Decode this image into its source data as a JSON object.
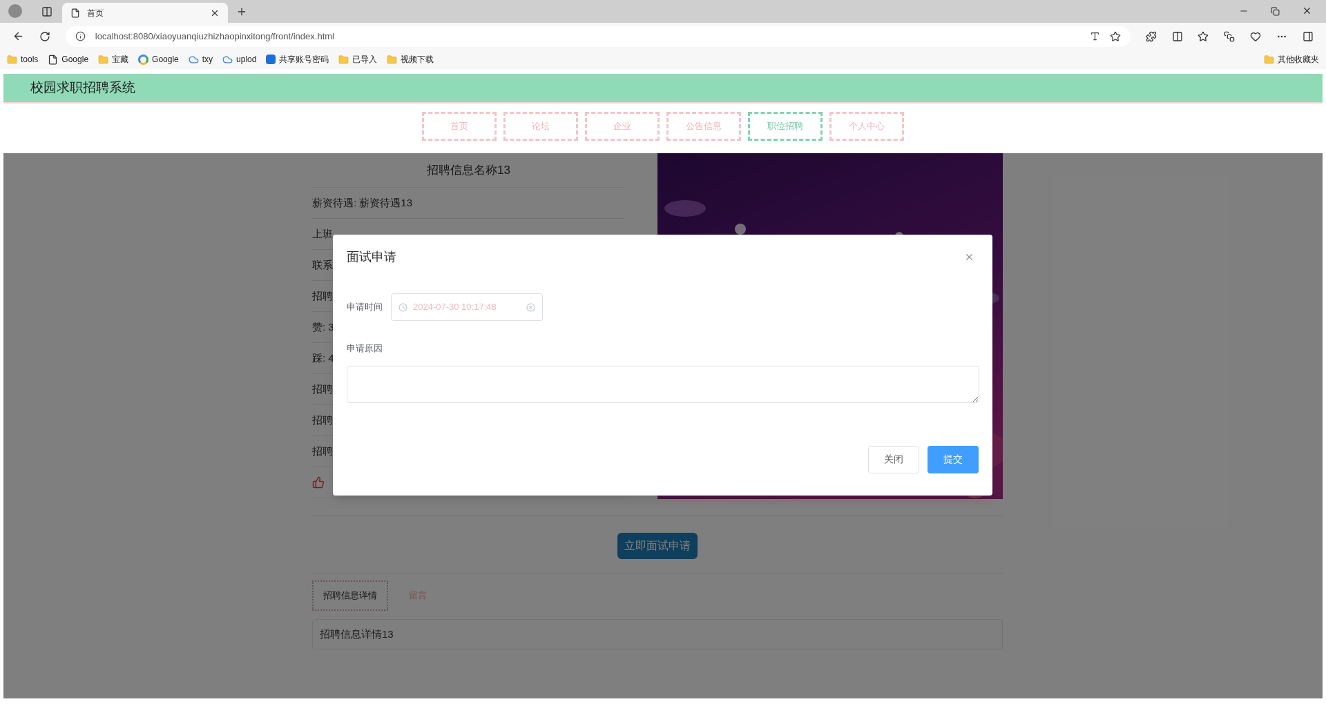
{
  "browser": {
    "tab_title": "首页",
    "url": "localhost:8080/xiaoyuanqiuzhizhaopinxitong/front/index.html",
    "bookmarks": [
      {
        "label": "tools",
        "kind": "folder"
      },
      {
        "label": "Google",
        "kind": "page"
      },
      {
        "label": "宝藏",
        "kind": "folder"
      },
      {
        "label": "Google",
        "kind": "google"
      },
      {
        "label": "txy",
        "kind": "cloud"
      },
      {
        "label": "uplod",
        "kind": "cloud"
      },
      {
        "label": "共享账号密码",
        "kind": "app"
      },
      {
        "label": "已导入",
        "kind": "folder"
      },
      {
        "label": "视频下载",
        "kind": "folder"
      }
    ],
    "other_bookmarks": "其他收藏夹"
  },
  "site": {
    "title": "校园求职招聘系统",
    "nav": [
      {
        "label": "首页",
        "selected": false
      },
      {
        "label": "论坛",
        "selected": false
      },
      {
        "label": "企业",
        "selected": false
      },
      {
        "label": "公告信息",
        "selected": false
      },
      {
        "label": "职位招聘",
        "selected": true
      },
      {
        "label": "个人中心",
        "selected": false
      }
    ]
  },
  "job": {
    "title": "招聘信息名称13",
    "fields": [
      "薪资待遇: 薪资待遇13",
      "上班",
      "联系",
      "招聘",
      "赞: 3",
      "踩: 4",
      "招聘",
      "招聘",
      "招聘"
    ],
    "apply_button": "立即面试申请",
    "tabs": [
      {
        "label": "招聘信息详情",
        "selected": true
      },
      {
        "label": "留言",
        "selected": false
      }
    ],
    "details": "招聘信息详情13"
  },
  "dialog": {
    "title": "面试申请",
    "fields": [
      {
        "label": "申请时间",
        "kind": "datetime",
        "value": "2024-07-30 10:17:48"
      },
      {
        "label": "申请原因",
        "kind": "textarea"
      }
    ],
    "buttons": [
      {
        "label": "关闭",
        "kind": "default"
      },
      {
        "label": "提交",
        "kind": "primary"
      }
    ]
  }
}
